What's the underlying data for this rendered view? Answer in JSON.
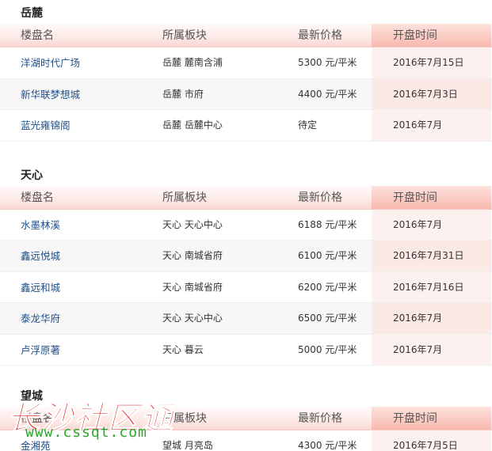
{
  "columns": [
    "楼盘名",
    "所属板块",
    "最新价格",
    "开盘时间"
  ],
  "sections": [
    {
      "title": "岳麓",
      "rows": [
        {
          "name": "洋湖时代广场",
          "district": "岳麓 麓南含浦",
          "price": "5300 元/平米",
          "open": "2016年7月15日"
        },
        {
          "name": "新华联梦想城",
          "district": "岳麓 市府",
          "price": "4400 元/平米",
          "open": "2016年7月3日"
        },
        {
          "name": "蓝光雍锦阁",
          "district": "岳麓 岳麓中心",
          "price": "待定",
          "open": "2016年7月"
        }
      ]
    },
    {
      "title": "天心",
      "rows": [
        {
          "name": "水墨林溪",
          "district": "天心 天心中心",
          "price": "6188 元/平米",
          "open": "2016年7月"
        },
        {
          "name": "鑫远悦城",
          "district": "天心 南城省府",
          "price": "6100 元/平米",
          "open": "2016年7月31日"
        },
        {
          "name": "鑫远和城",
          "district": "天心 南城省府",
          "price": "6200 元/平米",
          "open": "2016年7月16日"
        },
        {
          "name": "泰龙华府",
          "district": "天心 天心中心",
          "price": "6500 元/平米",
          "open": "2016年7月"
        },
        {
          "name": "卢浮原著",
          "district": "天心 暮云",
          "price": "5000 元/平米",
          "open": "2016年7月"
        }
      ]
    },
    {
      "title": "望城",
      "rows": [
        {
          "name": "金湘苑",
          "district": "望城 月亮岛",
          "price": "4300 元/平米",
          "open": "2016年7月5日"
        }
      ]
    }
  ],
  "watermark": {
    "brand": "长沙社区通",
    "url": "www.cssqt.com"
  }
}
